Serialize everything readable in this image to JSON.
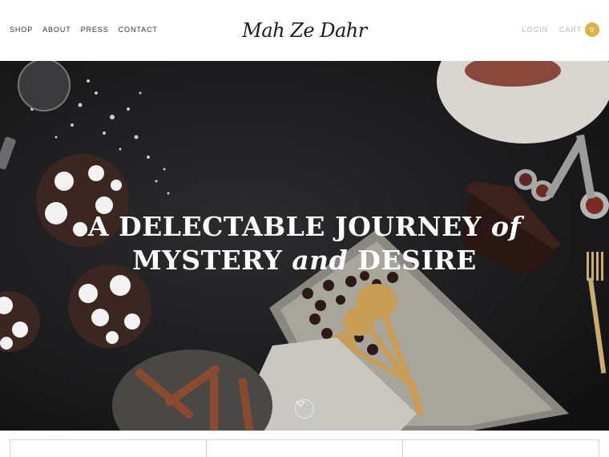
{
  "header": {
    "nav": [
      "SHOP",
      "ABOUT",
      "PRESS",
      "CONTACT"
    ],
    "logo": "Mah Ze Dahr",
    "login": "LOGIN",
    "cart_label": "CART",
    "cart_count": "0"
  },
  "hero": {
    "line1": "A DELECTABLE JOURNEY",
    "line1_tail": "of",
    "line2_a": "MYSTERY",
    "line2_and": "and",
    "line2_b": "DESIRE",
    "scroll_icon": "chevron-down-circle-icon"
  },
  "colors": {
    "accent": "#d9b24a",
    "hero_bg": "#1c1c1e",
    "muted_text": "#b8b8b8"
  }
}
